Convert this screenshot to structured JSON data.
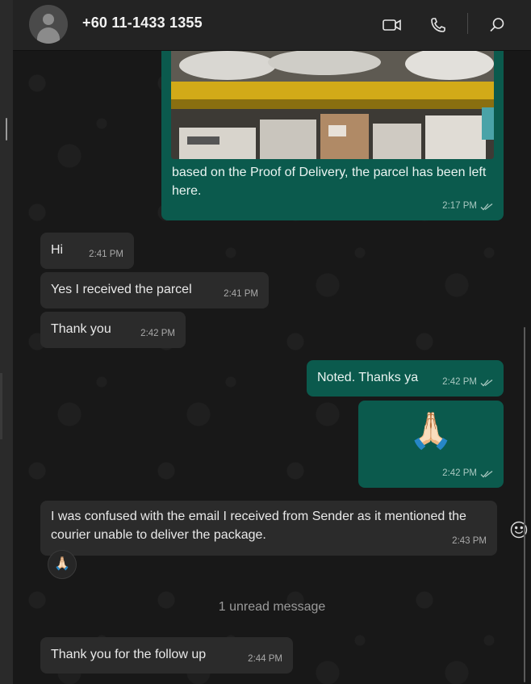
{
  "header": {
    "contact_name": "+60 11-1433 1355",
    "icons": [
      "video-call-icon",
      "voice-call-icon",
      "search-icon"
    ]
  },
  "messages": [
    {
      "id": "m1",
      "direction": "outgoing",
      "type": "image_with_caption",
      "text": "based on the Proof of Delivery, the parcel has been left here.",
      "time": "2:17 PM",
      "status": "read"
    },
    {
      "id": "m2",
      "direction": "incoming",
      "text": "Hi",
      "time": "2:41 PM"
    },
    {
      "id": "m3",
      "direction": "incoming",
      "text": "Yes I received the parcel",
      "time": "2:41 PM"
    },
    {
      "id": "m4",
      "direction": "incoming",
      "text": "Thank you",
      "time": "2:42 PM"
    },
    {
      "id": "m5",
      "direction": "outgoing",
      "text": "Noted. Thanks ya",
      "time": "2:42 PM",
      "status": "read"
    },
    {
      "id": "m6",
      "direction": "outgoing",
      "type": "emoji",
      "text": "🙏🏻",
      "time": "2:42 PM",
      "status": "read"
    },
    {
      "id": "m7",
      "direction": "incoming",
      "text": "I was confused with the email I received from Sender as it mentioned the courier unable to deliver the package.",
      "time": "2:43 PM",
      "reaction": "🙏🏻"
    },
    {
      "id": "m8",
      "direction": "incoming",
      "text": "Thank you for the follow up",
      "time": "2:44 PM"
    }
  ],
  "unread_divider": "1 unread message",
  "colors": {
    "incoming_bubble": "#2b2b2b",
    "outgoing_bubble": "#0b5a4d",
    "background": "#181818",
    "header": "#232323"
  }
}
